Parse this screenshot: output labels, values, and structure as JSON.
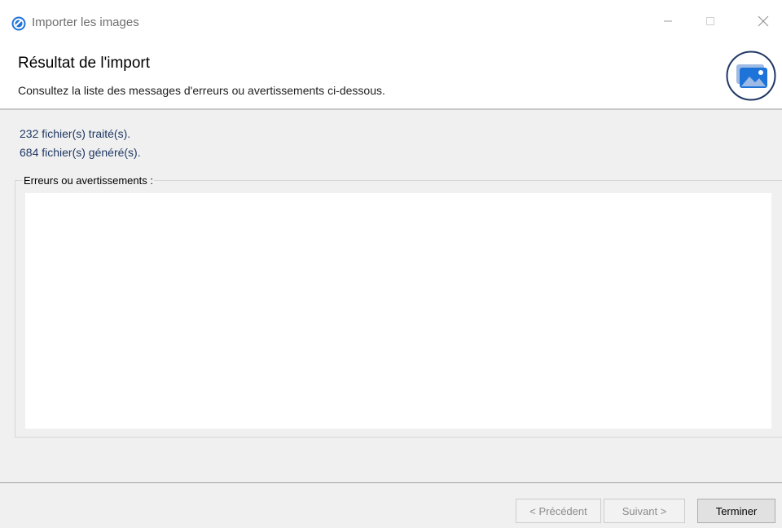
{
  "window": {
    "title": "Importer les images",
    "icon": "app-logo-icon",
    "controls": [
      "minimize-icon",
      "maximize-icon",
      "close-icon"
    ]
  },
  "header": {
    "title": "Résultat de l'import",
    "subtitle": "Consultez la liste des messages d'erreurs ou avertissements ci-dessous.",
    "icon": "image-icon"
  },
  "summary": {
    "processed": "232 fichier(s) traité(s).",
    "generated": "684 fichier(s) généré(s)."
  },
  "errors": {
    "label": "Erreurs ou avertissements :",
    "items": []
  },
  "buttons": {
    "previous": "< Précédent",
    "next": "Suivant >",
    "finish": "Terminer"
  },
  "colors": {
    "accent": "#1f3864",
    "app_icon": "#1e73d9",
    "dialog_bg": "#f0f0f0"
  }
}
